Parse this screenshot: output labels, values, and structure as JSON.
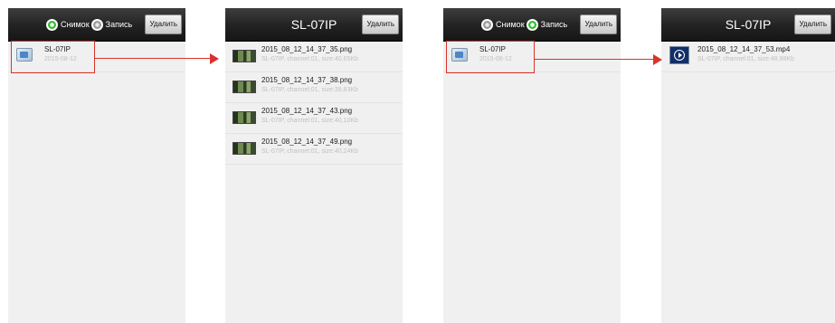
{
  "panel1": {
    "radio_snapshot": "Снимок",
    "radio_record": "Запись",
    "delete_label": "Удалить",
    "items": [
      {
        "title": "SL-07IP",
        "sub": "2015-08-12"
      }
    ]
  },
  "panel2": {
    "title": "SL-07IP",
    "delete_label": "Удалить",
    "items": [
      {
        "title": "2015_08_12_14_37_35.png",
        "sub": "SL-07IP, channel:01, size:40,65Kb"
      },
      {
        "title": "2015_08_12_14_37_38.png",
        "sub": "SL-07IP, channel:01, size:39,83Kb"
      },
      {
        "title": "2015_08_12_14_37_43.png",
        "sub": "SL-07IP, channel:01, size:40,10Kb"
      },
      {
        "title": "2015_08_12_14_37_49.png",
        "sub": "SL-07IP, channel:01, size:40,24Kb"
      }
    ]
  },
  "panel3": {
    "radio_snapshot": "Снимок",
    "radio_record": "Запись",
    "delete_label": "Удалить",
    "items": [
      {
        "title": "SL-07IP",
        "sub": "2015-08-12"
      }
    ]
  },
  "panel4": {
    "title": "SL-07IP",
    "delete_label": "Удалить",
    "items": [
      {
        "title": "2015_08_12_14_37_53.mp4",
        "sub": "SL-07IP, channel:01, size:48,98Kb"
      }
    ]
  },
  "colors": {
    "snapshot_selected": "#2fbf2f",
    "annotation_red": "#d9332c"
  },
  "icons": {
    "folder": "folder-icon",
    "image_thumbnail": "thumbnail-icon",
    "video": "video-play-icon",
    "radio_on": "radio-on-icon",
    "radio_off": "radio-off-icon"
  }
}
